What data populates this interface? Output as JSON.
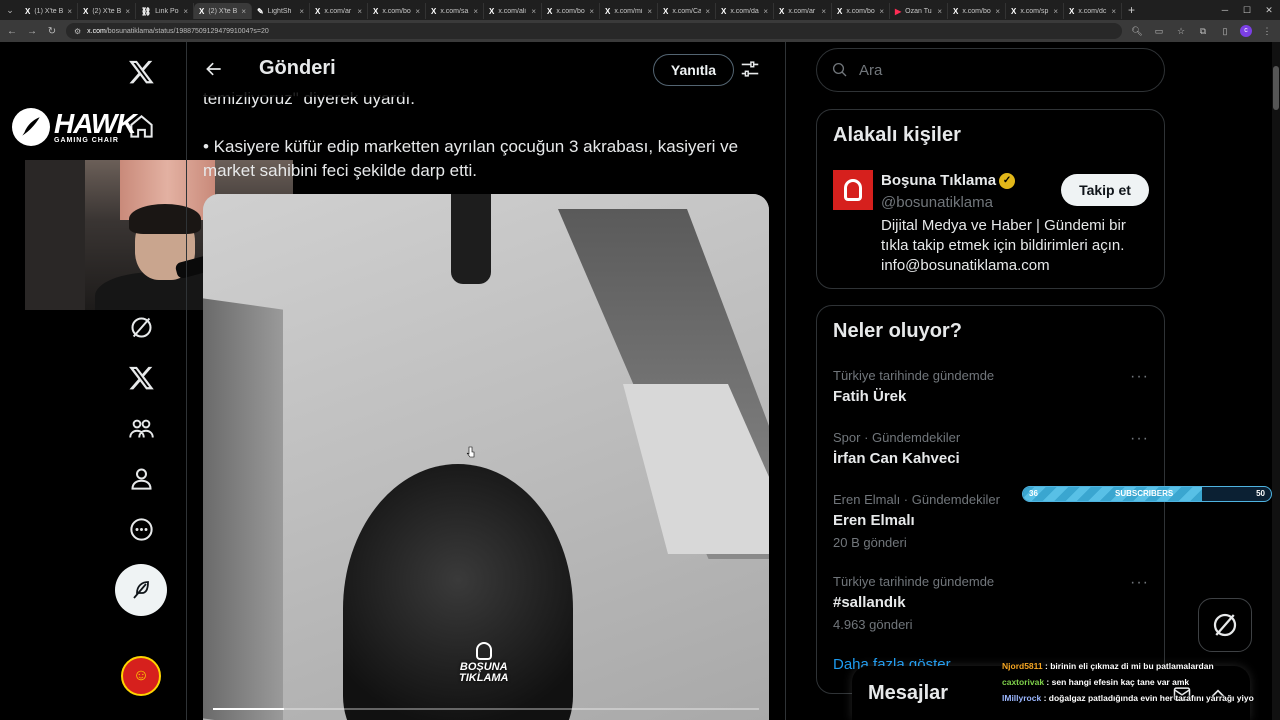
{
  "browser": {
    "tabs": [
      {
        "label": "(1) X'te B",
        "active": false,
        "icon": "x-icon"
      },
      {
        "label": "(2) X'te B",
        "active": false,
        "icon": "x-icon"
      },
      {
        "label": "Link Polis",
        "active": false,
        "icon": "link-icon"
      },
      {
        "label": "(2) X'te B",
        "active": true,
        "icon": "x-icon"
      },
      {
        "label": "LightSh",
        "active": false,
        "icon": "lightshot-icon"
      },
      {
        "label": "x.com/ar",
        "active": false,
        "icon": "x-icon"
      },
      {
        "label": "x.com/bo",
        "active": false,
        "icon": "x-icon"
      },
      {
        "label": "x.com/sa",
        "active": false,
        "icon": "x-icon"
      },
      {
        "label": "x.com/ali",
        "active": false,
        "icon": "x-icon"
      },
      {
        "label": "x.com/bo",
        "active": false,
        "icon": "x-icon"
      },
      {
        "label": "x.com/mi",
        "active": false,
        "icon": "x-icon"
      },
      {
        "label": "x.com/Ca",
        "active": false,
        "icon": "x-icon"
      },
      {
        "label": "x.com/da",
        "active": false,
        "icon": "x-icon"
      },
      {
        "label": "x.com/ar",
        "active": false,
        "icon": "x-icon"
      },
      {
        "label": "x.com/bo",
        "active": false,
        "icon": "x-icon"
      },
      {
        "label": "Ozan Tu",
        "active": false,
        "icon": "youtube-icon"
      },
      {
        "label": "x.com/bo",
        "active": false,
        "icon": "x-icon"
      },
      {
        "label": "x.com/sp",
        "active": false,
        "icon": "x-icon"
      },
      {
        "label": "x.com/dc",
        "active": false,
        "icon": "x-icon"
      }
    ],
    "url_host": "x.com",
    "url_path": "/bosunatiklama/status/1988750912947991004?s=20"
  },
  "overlay": {
    "brand_main": "HAWK",
    "brand_sub": "GAMING CHAIR",
    "subscribers_label": "SUBSCRIBERS",
    "subscribers_current": "36",
    "subscribers_goal": "50",
    "subscribers_progress": 0.72,
    "chat": [
      {
        "user": "Njord5811",
        "color": "#f5a623",
        "message": "birinin eli çıkmaz di mi bu patlamalardan"
      },
      {
        "user": "caxtorivak",
        "color": "#7fd14b",
        "message": "sen hangi efesin kaç tane var amk"
      },
      {
        "user": "lMillyrock",
        "color": "#9bb7ff",
        "message": "doğalgaz patladığında evin her tarafını yarrağı yiyo"
      }
    ]
  },
  "header": {
    "title": "Gönderi",
    "reply_label": "Yanıtla"
  },
  "post": {
    "line1": "temizliyoruz\" diyerek uyardı.",
    "line2": "• Kasiyere küfür edip marketten ayrılan çocuğun 3 akrabası, kasiyeri ve",
    "line3": "market sahibini feci şekilde darp etti.",
    "watermark_line1": "BOŞUNA",
    "watermark_line2": "TIKLAMA",
    "video_progress": 0.13
  },
  "search": {
    "placeholder": "Ara"
  },
  "related": {
    "title": "Alakalı kişiler",
    "name": "Boşuna Tıklama",
    "handle": "@bosunatiklama",
    "bio": "Dijital Medya ve Haber | Gündemi bir tıkla takip etmek için bildirimleri açın. info@bosunatiklama.com",
    "follow_label": "Takip et"
  },
  "trends": {
    "title": "Neler oluyor?",
    "items": [
      {
        "context": "Türkiye tarihinde gündemde",
        "name": "Fatih Ürek",
        "count": ""
      },
      {
        "context": "Spor · Gündemdekiler",
        "name": "İrfan Can Kahveci",
        "count": ""
      },
      {
        "context": "Eren Elmalı · Gündemdekiler",
        "name": "Eren Elmalı",
        "count": "20 B gönderi"
      },
      {
        "context": "Türkiye tarihinde gündemde",
        "name": "#sallandık",
        "count": "4.963 gönderi"
      }
    ],
    "show_more": "Daha fazla göster"
  },
  "messages": {
    "title": "Mesajlar"
  },
  "colors": {
    "accent": "#1d9bf0",
    "background": "#000000",
    "border": "#2f3336"
  }
}
